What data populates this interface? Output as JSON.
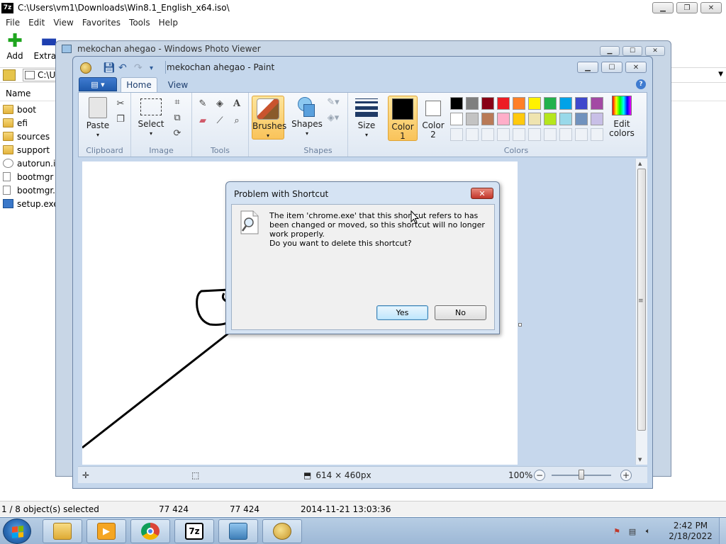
{
  "sevenzip": {
    "title": "C:\\Users\\vm1\\Downloads\\Win8.1_English_x64.iso\\",
    "menu": [
      "File",
      "Edit",
      "View",
      "Favorites",
      "Tools",
      "Help"
    ],
    "toolbar": {
      "add_label": "Add",
      "extract_label": "Extract"
    },
    "address_value": "C:\\U",
    "column_name": "Name",
    "files": [
      {
        "name": "boot",
        "type": "folder"
      },
      {
        "name": "efi",
        "type": "folder"
      },
      {
        "name": "sources",
        "type": "folder"
      },
      {
        "name": "support",
        "type": "folder"
      },
      {
        "name": "autorun.inf",
        "type": "inf"
      },
      {
        "name": "bootmgr",
        "type": "doc"
      },
      {
        "name": "bootmgr.efi",
        "type": "doc"
      },
      {
        "name": "setup.exe",
        "type": "exe"
      }
    ],
    "status": {
      "selection": "1 / 8 object(s) selected",
      "size": "77 424",
      "packed_size": "77 424",
      "modified": "2014-11-21 13:03:36"
    }
  },
  "photo_viewer": {
    "title": "mekochan ahegao - Windows Photo Viewer"
  },
  "paint": {
    "title": "mekochan ahegao - Paint",
    "tabs": {
      "home": "Home",
      "view": "View"
    },
    "groups": {
      "clipboard": "Clipboard",
      "image": "Image",
      "tools": "Tools",
      "shapes": "Shapes",
      "colors": "Colors"
    },
    "buttons": {
      "paste": "Paste",
      "select": "Select",
      "brushes": "Brushes",
      "shapes": "Shapes",
      "size": "Size",
      "color1_line1": "Color",
      "color1_line2": "1",
      "color2_line1": "Color",
      "color2_line2": "2",
      "edit_colors_line1": "Edit",
      "edit_colors_line2": "colors"
    },
    "color1": "#000000",
    "color2": "#ffffff",
    "palette_row1": [
      "#000000",
      "#7f7f7f",
      "#880015",
      "#ed1c24",
      "#ff7f27",
      "#fff200",
      "#22b14c",
      "#00a2e8",
      "#3f48cc",
      "#a349a4"
    ],
    "palette_row2": [
      "#ffffff",
      "#c3c3c3",
      "#b97a57",
      "#ffaec9",
      "#ffc90e",
      "#efe4b0",
      "#b5e61d",
      "#99d9ea",
      "#7092be",
      "#c8bfe7"
    ],
    "status": {
      "dimensions": "614 × 460px",
      "zoom": "100%"
    }
  },
  "dialog": {
    "title": "Problem with Shortcut",
    "message": "The item 'chrome.exe' that this shortcut refers to has been changed or moved, so this shortcut will no longer work properly.",
    "question": "Do you want to delete this shortcut?",
    "yes_label": "Yes",
    "no_label": "No"
  },
  "taskbar": {
    "time": "2:42 PM",
    "date": "2/18/2022"
  }
}
